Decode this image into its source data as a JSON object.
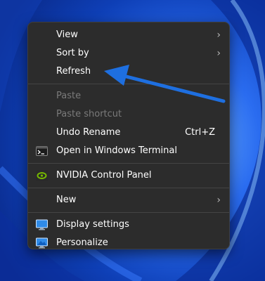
{
  "menu": {
    "items": [
      {
        "label": "View",
        "icon": "",
        "has_submenu": true
      },
      {
        "label": "Sort by",
        "icon": "",
        "has_submenu": true
      },
      {
        "label": "Refresh",
        "icon": ""
      },
      {
        "label": "Paste",
        "disabled": true
      },
      {
        "label": "Paste shortcut",
        "disabled": true
      },
      {
        "label": "Undo Rename",
        "shortcut": "Ctrl+Z"
      },
      {
        "label": "Open in Windows Terminal",
        "icon": "terminal-icon"
      },
      {
        "label": "NVIDIA Control Panel",
        "icon": "nvidia-icon"
      },
      {
        "label": "New",
        "has_submenu": true
      },
      {
        "label": "Display settings",
        "icon": "display-icon"
      },
      {
        "label": "Personalize",
        "icon": "personalize-icon"
      }
    ],
    "chevron": "›"
  },
  "colors": {
    "menu_bg": "#2c2c2c",
    "arrow": "#1e6fe0",
    "wallpaper_base": "#1a4fcf"
  }
}
